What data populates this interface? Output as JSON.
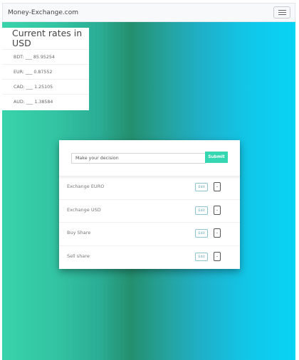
{
  "navbar": {
    "brand": "Money-Exchange.com",
    "menu_icon": "hamburger-icon"
  },
  "rates": {
    "title": "Current rates in USD",
    "items": [
      {
        "label": "BDT: ___ 85.95254"
      },
      {
        "label": "EUR: ___ 0.87552"
      },
      {
        "label": "CAD: ___ 1.25105"
      },
      {
        "label": "AUD: ___ 1.38584"
      }
    ]
  },
  "decision": {
    "placeholder": "Make your decision",
    "submit_label": "Submit"
  },
  "list": {
    "items": [
      {
        "label": "Exchange EURO",
        "edit": "Edit",
        "delete": "-"
      },
      {
        "label": "Exchange USD",
        "edit": "Edit",
        "delete": "-"
      },
      {
        "label": "Buy Share",
        "edit": "Edit",
        "delete": "-"
      },
      {
        "label": "Sell share",
        "edit": "Edit",
        "delete": "-"
      }
    ]
  },
  "colors": {
    "submit": "#35d7b1",
    "gradient_left": "#38d3aa",
    "gradient_mid": "#248f6e",
    "gradient_right": "#08d4f5"
  }
}
